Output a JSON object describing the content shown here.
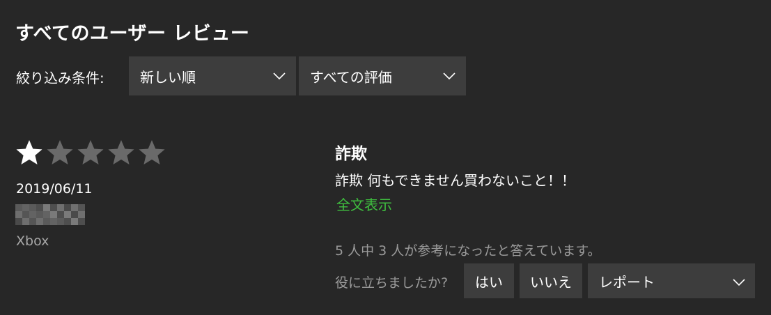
{
  "header": {
    "title": "すべてのユーザー レビュー"
  },
  "filters": {
    "label": "絞り込み条件:",
    "sort": {
      "selected": "新しい順",
      "icon": "chevron-down-icon"
    },
    "rating": {
      "selected": "すべての評価",
      "icon": "chevron-down-icon"
    }
  },
  "review": {
    "rating": 1,
    "max_rating": 5,
    "colors": {
      "star_filled": "#ffffff",
      "star_empty": "#6a6a6a",
      "link": "#3fbf3f"
    },
    "date": "2019/06/11",
    "device": "Xbox",
    "title": "詐欺",
    "body": "詐欺 何もできません買わないこと！！",
    "show_full_label": "全文表示",
    "helpful_count_text": "5 人中 3 人が参考になったと答えています。",
    "helpful_question": "役に立ちましたか?",
    "yes_label": "はい",
    "no_label": "いいえ",
    "report_label": "レポート"
  }
}
